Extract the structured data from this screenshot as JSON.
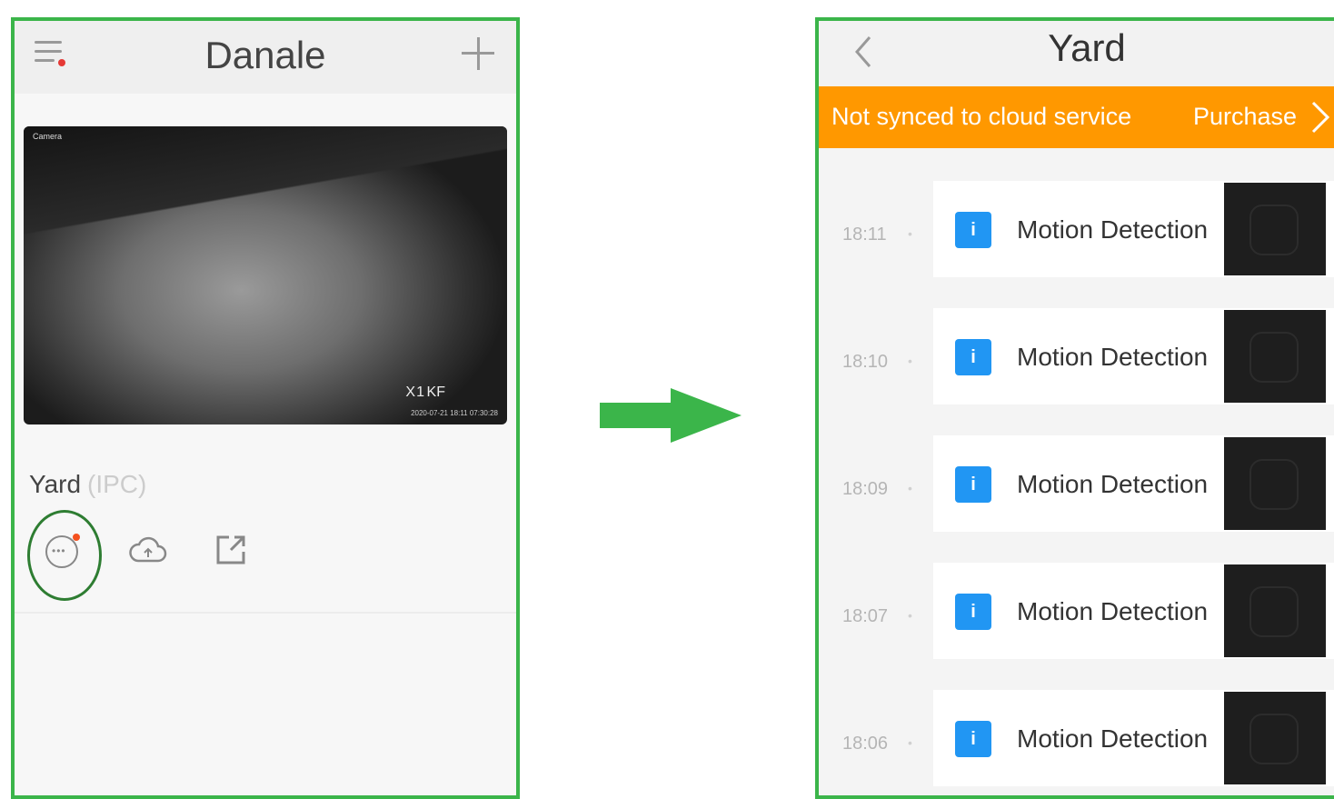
{
  "left_screen": {
    "header": {
      "title": "Danale",
      "menu_icon": "menu-icon",
      "add_icon": "plus-icon"
    },
    "video": {
      "overlay_label": "Camera",
      "zoom_text": "X1",
      "rate_text": "KF",
      "timestamp": "2020-07-21  18:11  07:30:28"
    },
    "device": {
      "name": "Yard",
      "type": "(IPC)"
    },
    "actions": [
      {
        "icon": "message-icon"
      },
      {
        "icon": "cloud-upload-icon"
      },
      {
        "icon": "share-icon"
      }
    ]
  },
  "right_screen": {
    "header": {
      "title": "Yard",
      "back_icon": "chevron-left-icon"
    },
    "banner": {
      "text": "Not synced to cloud service",
      "link": "Purchase",
      "color": "#ff9800"
    },
    "events": [
      {
        "time": "18:11",
        "label": "Motion Detection"
      },
      {
        "time": "18:10",
        "label": "Motion Detection"
      },
      {
        "time": "18:09",
        "label": "Motion Detection"
      },
      {
        "time": "18:07",
        "label": "Motion Detection"
      },
      {
        "time": "18:06",
        "label": "Motion Detection"
      }
    ]
  },
  "colors": {
    "frame": "#3bb54a",
    "arrow": "#3bb54a",
    "badge": "#2196f3"
  }
}
